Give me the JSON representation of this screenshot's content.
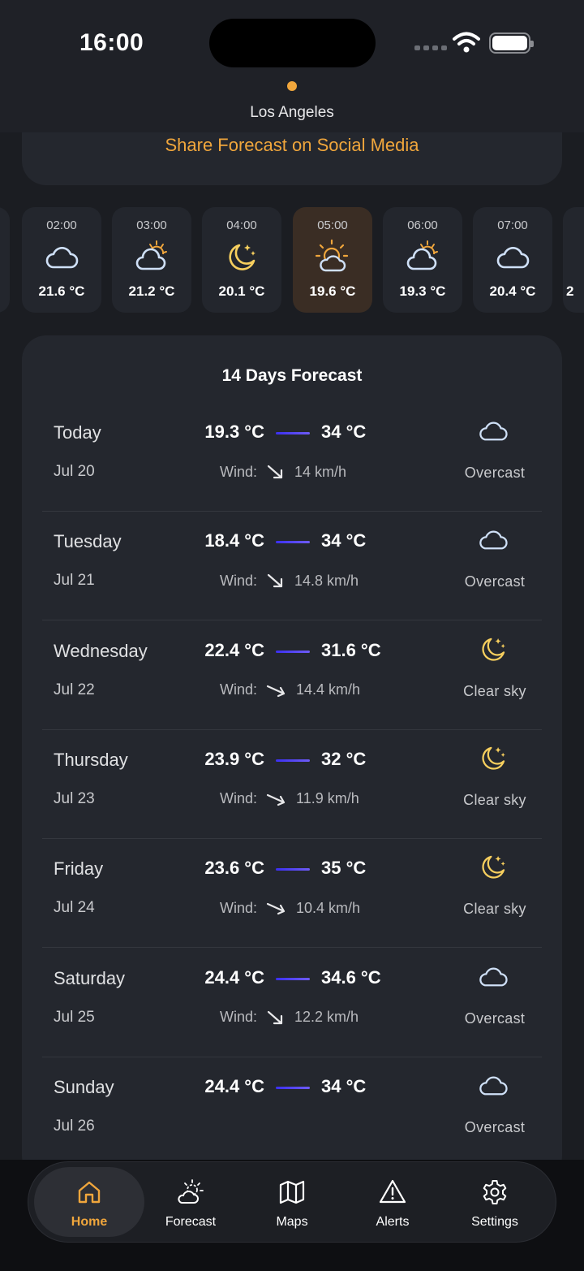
{
  "status_bar": {
    "time": "16:00"
  },
  "header": {
    "city": "Los Angeles"
  },
  "share": {
    "label": "Share Forecast on Social Media"
  },
  "hourly": [
    {
      "time": "02:00",
      "icon": "cloud-icon",
      "temp": "21.6 °C"
    },
    {
      "time": "03:00",
      "icon": "partly-cloudy-icon",
      "temp": "21.2 °C"
    },
    {
      "time": "04:00",
      "icon": "moon-stars-icon",
      "temp": "20.1 °C"
    },
    {
      "time": "05:00",
      "icon": "sun-cloud-icon",
      "temp": "19.6 °C",
      "active": true
    },
    {
      "time": "06:00",
      "icon": "partly-cloudy-icon",
      "temp": "19.3 °C"
    },
    {
      "time": "07:00",
      "icon": "cloud-icon",
      "temp": "20.4 °C"
    },
    {
      "time": "",
      "icon": "",
      "temp": "2"
    }
  ],
  "forecast": {
    "title": "14 Days Forecast",
    "wind_label": "Wind:",
    "days": [
      {
        "name": "Today",
        "date": "Jul 20",
        "low": "19.3 °C",
        "high": "34 °C",
        "wind": "14 km/h",
        "condition": "Overcast",
        "icon": "cloud-icon"
      },
      {
        "name": "Tuesday",
        "date": "Jul 21",
        "low": "18.4 °C",
        "high": "34 °C",
        "wind": "14.8 km/h",
        "condition": "Overcast",
        "icon": "cloud-icon"
      },
      {
        "name": "Wednesday",
        "date": "Jul 22",
        "low": "22.4 °C",
        "high": "31.6 °C",
        "wind": "14.4 km/h",
        "condition": "Clear sky",
        "icon": "moon-stars-icon"
      },
      {
        "name": "Thursday",
        "date": "Jul 23",
        "low": "23.9 °C",
        "high": "32 °C",
        "wind": "11.9 km/h",
        "condition": "Clear sky",
        "icon": "moon-stars-icon"
      },
      {
        "name": "Friday",
        "date": "Jul 24",
        "low": "23.6 °C",
        "high": "35 °C",
        "wind": "10.4 km/h",
        "condition": "Clear sky",
        "icon": "moon-stars-icon"
      },
      {
        "name": "Saturday",
        "date": "Jul 25",
        "low": "24.4 °C",
        "high": "34.6 °C",
        "wind": "12.2 km/h",
        "condition": "Overcast",
        "icon": "cloud-icon"
      },
      {
        "name": "Sunday",
        "date": "Jul 26",
        "low": "24.4 °C",
        "high": "34 °C",
        "wind": "",
        "condition": "Overcast",
        "icon": "cloud-icon"
      }
    ]
  },
  "nav": [
    {
      "label": "Home",
      "icon": "home-icon",
      "active": true
    },
    {
      "label": "Forecast",
      "icon": "sun-cloud-icon"
    },
    {
      "label": "Maps",
      "icon": "map-icon"
    },
    {
      "label": "Alerts",
      "icon": "alert-triangle-icon"
    },
    {
      "label": "Settings",
      "icon": "gear-icon"
    }
  ],
  "colors": {
    "accent": "#f0a63c",
    "bar_start": "#3b2ff0",
    "bar_end": "#6e5cf5",
    "active_hour_bg": "#3a2d24"
  }
}
